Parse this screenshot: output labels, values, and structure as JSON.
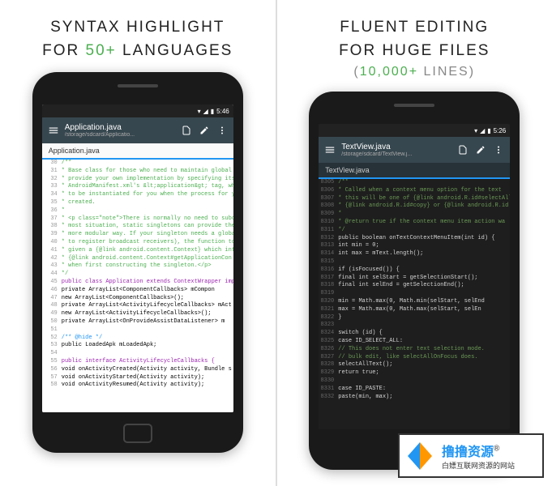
{
  "headings": {
    "left_l1": "SYNTAX HIGHLIGHT",
    "left_l2a": "FOR ",
    "left_l2b": "50+",
    "left_l2c": " LANGUAGES",
    "right_l1": "FLUENT EDITING",
    "right_l2": "FOR HUGE FILES",
    "right_l3a": "(",
    "right_l3b": "10,000+",
    "right_l3c": " LINES)"
  },
  "status": {
    "time_left": "5:46",
    "time_right": "5:26"
  },
  "left": {
    "filename": "Application.java",
    "filepath": "/storage/sdcard/Applicatio...",
    "tab": "Application.java",
    "lines": [
      {
        "n": "30",
        "cls": "c-green",
        "t": "/**"
      },
      {
        "n": "31",
        "cls": "c-green",
        "t": " * Base class for those who need to maintain global a"
      },
      {
        "n": "32",
        "cls": "c-green",
        "t": " * provide your own implementation by specifying its"
      },
      {
        "n": "33",
        "cls": "c-green",
        "t": " * AndroidManifest.xml's &lt;application&gt; tag, whic"
      },
      {
        "n": "34",
        "cls": "c-green",
        "t": " * to be instantiated for you when the process for yo"
      },
      {
        "n": "35",
        "cls": "c-green",
        "t": " * created."
      },
      {
        "n": "36",
        "cls": "c-green",
        "t": " *"
      },
      {
        "n": "37",
        "cls": "c-green",
        "t": " * <p class=\"note\">There is normally no need to subcl"
      },
      {
        "n": "38",
        "cls": "c-green",
        "t": " * most situation, static singletons can provide the sa"
      },
      {
        "n": "39",
        "cls": "c-green",
        "t": " * more modular way. If your singleton needs a globa"
      },
      {
        "n": "40",
        "cls": "c-green",
        "t": " * to register broadcast receivers), the function to ret"
      },
      {
        "n": "41",
        "cls": "c-green",
        "t": " * given a {@link android.content.Context} which inte"
      },
      {
        "n": "42",
        "cls": "c-green",
        "t": " * {@link android.content.Context#getApplicationCon"
      },
      {
        "n": "43",
        "cls": "c-green",
        "t": " * when first constructing the singleton.</p>"
      },
      {
        "n": "44",
        "cls": "c-green",
        "t": " */"
      },
      {
        "n": "45",
        "cls": "c-purple",
        "t": "public class Application extends ContextWrapper imp"
      },
      {
        "n": "46",
        "cls": "",
        "t": "    private ArrayList<ComponentCallbacks> mCompon"
      },
      {
        "n": "47",
        "cls": "",
        "t": "        new ArrayList<ComponentCallbacks>();"
      },
      {
        "n": "48",
        "cls": "",
        "t": "    private ArrayList<ActivityLifecycleCallbacks> mAct"
      },
      {
        "n": "49",
        "cls": "",
        "t": "        new ArrayList<ActivityLifecycleCallbacks>();"
      },
      {
        "n": "50",
        "cls": "",
        "t": "    private ArrayList<OnProvideAssistDataListener> m"
      },
      {
        "n": "51",
        "cls": "",
        "t": ""
      },
      {
        "n": "52",
        "cls": "c-blue",
        "t": "    /** @hide */"
      },
      {
        "n": "53",
        "cls": "",
        "t": "    public LoadedApk mLoadedApk;"
      },
      {
        "n": "54",
        "cls": "",
        "t": ""
      },
      {
        "n": "55",
        "cls": "c-purple",
        "t": "    public interface ActivityLifecycleCallbacks {"
      },
      {
        "n": "56",
        "cls": "",
        "t": "        void onActivityCreated(Activity activity, Bundle s"
      },
      {
        "n": "57",
        "cls": "",
        "t": "        void onActivityStarted(Activity activity);"
      },
      {
        "n": "58",
        "cls": "",
        "t": "        void onActivityResumed(Activity activity);"
      }
    ]
  },
  "right": {
    "filename": "TextView.java",
    "filepath": "/storage/sdcard/TextView.j...",
    "tab": "TextView.java",
    "lines": [
      {
        "n": "8305",
        "cls": "c-dgreen",
        "t": "  /**"
      },
      {
        "n": "8306",
        "cls": "c-dgreen",
        "t": "   * Called when a context menu option for the text"
      },
      {
        "n": "8307",
        "cls": "c-dgreen",
        "t": "   * this will be one of {@link android.R.id#selectAll"
      },
      {
        "n": "8308",
        "cls": "c-dgreen",
        "t": "   * {@link android.R.id#copy} or {@link android.R.id"
      },
      {
        "n": "8309",
        "cls": "c-dgreen",
        "t": "   *"
      },
      {
        "n": "8310",
        "cls": "c-dgreen",
        "t": "   * @return true if the context menu item action wa"
      },
      {
        "n": "8311",
        "cls": "c-dgreen",
        "t": "   */"
      },
      {
        "n": "8312",
        "cls": "c-dwhite",
        "t": "  public boolean onTextContextMenuItem(int id) {"
      },
      {
        "n": "8313",
        "cls": "c-dwhite",
        "t": "    int min = 0;"
      },
      {
        "n": "8314",
        "cls": "c-dwhite",
        "t": "    int max = mText.length();"
      },
      {
        "n": "8315",
        "cls": "",
        "t": ""
      },
      {
        "n": "8316",
        "cls": "c-dwhite",
        "t": "    if (isFocused()) {"
      },
      {
        "n": "8317",
        "cls": "c-dwhite",
        "t": "      final int selStart = getSelectionStart();"
      },
      {
        "n": "8318",
        "cls": "c-dwhite",
        "t": "      final int selEnd = getSelectionEnd();"
      },
      {
        "n": "8319",
        "cls": "",
        "t": ""
      },
      {
        "n": "8320",
        "cls": "c-dwhite",
        "t": "      min = Math.max(0, Math.min(selStart, selEnd"
      },
      {
        "n": "8321",
        "cls": "c-dwhite",
        "t": "      max = Math.max(0, Math.max(selStart, selEn"
      },
      {
        "n": "8322",
        "cls": "c-dwhite",
        "t": "    }"
      },
      {
        "n": "8323",
        "cls": "",
        "t": ""
      },
      {
        "n": "8324",
        "cls": "c-dwhite",
        "t": "    switch (id) {"
      },
      {
        "n": "8325",
        "cls": "c-dwhite",
        "t": "      case ID_SELECT_ALL:"
      },
      {
        "n": "8326",
        "cls": "c-dgreen",
        "t": "        // This does not enter text selection mode."
      },
      {
        "n": "8327",
        "cls": "c-dgreen",
        "t": "        // bulk edit, like selectAllOnFocus does."
      },
      {
        "n": "8328",
        "cls": "c-dwhite",
        "t": "        selectAllText();"
      },
      {
        "n": "8329",
        "cls": "c-dwhite",
        "t": "        return true;"
      },
      {
        "n": "8330",
        "cls": "",
        "t": ""
      },
      {
        "n": "8331",
        "cls": "c-dwhite",
        "t": "      case ID_PASTE:"
      },
      {
        "n": "8332",
        "cls": "c-dwhite",
        "t": "        paste(min, max);"
      }
    ]
  },
  "watermark": {
    "main": "撸撸资源",
    "reg": "®",
    "sub": "白嫖互联网资源的网站"
  }
}
